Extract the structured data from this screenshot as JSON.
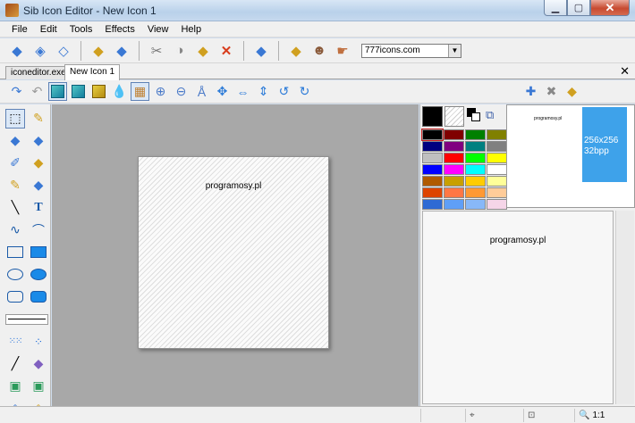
{
  "window": {
    "title": "Sib Icon Editor - New Icon 1"
  },
  "menu": [
    "File",
    "Edit",
    "Tools",
    "Effects",
    "View",
    "Help"
  ],
  "toolbar": {
    "groups": [
      [
        "new-icon",
        "open-icon",
        "save-icon"
      ],
      [
        "import-icon",
        "export-icon"
      ],
      [
        "cut-icon",
        "copy-icon",
        "paste-icon",
        "delete-icon"
      ],
      [
        "clear-icon"
      ],
      [
        "properties-icon",
        "wizard-icon",
        "hand-pointer-icon"
      ]
    ],
    "combo_value": "777icons.com"
  },
  "tabs": [
    {
      "label": "iconeditor.exe",
      "active": false
    },
    {
      "label": "New Icon 1",
      "active": true
    }
  ],
  "toolbar2": {
    "items": [
      "redo-icon",
      "undo-icon",
      "image-mode-icon",
      "mask-mode-icon",
      "blend-mode-icon",
      "drop-icon",
      "grid-icon",
      "zoom-in-icon",
      "zoom-out-icon",
      "zoom-actual-icon",
      "move-icon",
      "flip-horizontal-icon",
      "flip-vertical-icon",
      "rotate-left-icon",
      "rotate-right-icon"
    ],
    "right_items": [
      "add-image-icon",
      "remove-image-icon",
      "image-list-icon"
    ]
  },
  "palette_tools": [
    [
      "select-rect-icon",
      "pencil-icon"
    ],
    [
      "eraser-icon",
      "brush-icon"
    ],
    [
      "color-picker-icon",
      "fill-bucket-icon"
    ],
    [
      "airbrush-icon",
      "smudge-icon"
    ],
    [
      "line-icon",
      "text-icon"
    ],
    [
      "curve-icon",
      "arc-icon"
    ],
    [
      "rectangle-icon",
      "filled-rectangle-icon"
    ],
    [
      "ellipse-icon",
      "filled-ellipse-icon"
    ],
    [
      "rounded-rect-icon",
      "filled-rounded-rect-icon"
    ],
    [
      "line-width-icon"
    ],
    [
      "dot-grid-icon",
      "dot-circle-icon"
    ],
    [
      "thin-line-icon",
      "eraser-big-icon"
    ],
    [
      "layer-copy-icon",
      "layer-merge-icon"
    ],
    [
      "image-import-icon",
      "image-effects-icon"
    ]
  ],
  "canvas": {
    "text": "programosy.pl"
  },
  "colors": {
    "primary": "#000000",
    "swatches": [
      "#000000",
      "#800000",
      "#008000",
      "#808000",
      "#000080",
      "#800080",
      "#008080",
      "#808080",
      "#c0c0c0",
      "#ff0000",
      "#00ff00",
      "#ffff00",
      "#0000ff",
      "#ff00ff",
      "#00ffff",
      "#ffffff",
      "#b05a00",
      "#c8a000",
      "#ffcc00",
      "#ffff99",
      "#dd4400",
      "#ff7744",
      "#ff9933",
      "#ffcc99",
      "#2e6ad4",
      "#5f9ff7",
      "#88b8f8",
      "#f5d5e8"
    ]
  },
  "preview": {
    "small_text": "programosy.pl",
    "size_label": "256x256",
    "depth_label": "32bpp",
    "large_text": "programosy.pl"
  },
  "status": {
    "zoom": "1:1"
  }
}
